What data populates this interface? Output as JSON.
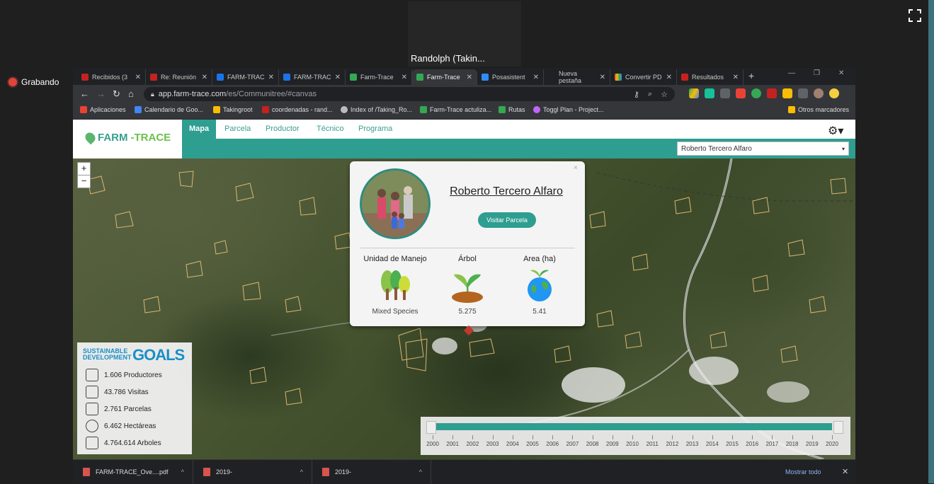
{
  "zoom": {
    "participant_name": "Randolph (Takin...",
    "recording_label": "Grabando"
  },
  "browser": {
    "tabs": [
      {
        "label": "Recibidos (3",
        "fav_color": "#c5221f"
      },
      {
        "label": "Re: Reunión",
        "fav_color": "#c5221f"
      },
      {
        "label": "FARM-TRAC",
        "fav_color": "#1a73e8"
      },
      {
        "label": "FARM-TRAC",
        "fav_color": "#1a73e8"
      },
      {
        "label": "Farm-Trace",
        "fav_color": "#34a853"
      },
      {
        "label": "Farm-Trace",
        "fav_color": "#34a853"
      },
      {
        "label": "Posasistent",
        "fav_color": "#2d8cff"
      },
      {
        "label": "Nueva pestaña",
        "fav_color": "#5f6368"
      },
      {
        "label": "Convertir PD",
        "fav_color": "#fbbc04"
      },
      {
        "label": "Resultados",
        "fav_color": "#c5221f"
      }
    ],
    "url_host": "app.farm-trace.com",
    "url_path": "/es/Communitree/#canvas",
    "bookmarks": [
      {
        "label": "Aplicaciones",
        "fav_color": "#ea4335"
      },
      {
        "label": "Calendario de Goo...",
        "fav_color": "#4285f4"
      },
      {
        "label": "Takingroot",
        "fav_color": "#fbbc04"
      },
      {
        "label": "coordenadas - rand...",
        "fav_color": "#c5221f"
      },
      {
        "label": "Index of /Taking_Ro...",
        "fav_color": "#bbbbbb"
      },
      {
        "label": "Farm-Trace actuliza...",
        "fav_color": "#34a853"
      },
      {
        "label": "Rutas",
        "fav_color": "#34a853"
      },
      {
        "label": "Toggl Plan - Project...",
        "fav_color": "#c264fe"
      }
    ],
    "other_bookmarks": "Otros marcadores"
  },
  "app": {
    "logo_farm": "FARM",
    "logo_trace": "-TRACE",
    "nav": [
      "Mapa",
      "Parcela",
      "Productor",
      "Técnico",
      "Programa"
    ],
    "selected_producer": "Roberto Tercero Alfaro"
  },
  "map": {
    "zoom_in": "+",
    "zoom_out": "−"
  },
  "popup": {
    "close": "×",
    "name": "Roberto Tercero Alfaro",
    "visit_button": "Visitar Parcela",
    "stats": [
      {
        "label": "Unidad de Manejo",
        "value": "Mixed Species",
        "icon": "trees-icon"
      },
      {
        "label": "Árbol",
        "value": "5.275",
        "icon": "sprout-icon"
      },
      {
        "label": "Area (ha)",
        "value": "5.41",
        "icon": "globe-plant-icon"
      }
    ]
  },
  "sdg": {
    "title_line1": "SUSTAINABLE",
    "title_line2": "DEVELOPMENT",
    "goals": "GOALS",
    "rows": [
      {
        "text": "1.606 Productores",
        "icon": "farmer-icon"
      },
      {
        "text": "43.786 Visitas",
        "icon": "clipboard-person-icon"
      },
      {
        "text": "2.761 Parcelas",
        "icon": "group-icon"
      },
      {
        "text": "6.462 Hectáreas",
        "icon": "land-icon"
      },
      {
        "text": "4.764.614 Arboles",
        "icon": "tree-hand-icon"
      }
    ]
  },
  "timeline": {
    "years": [
      "2000",
      "2001",
      "2002",
      "2003",
      "2004",
      "2005",
      "2006",
      "2007",
      "2008",
      "2009",
      "2010",
      "2011",
      "2012",
      "2013",
      "2014",
      "2015",
      "2016",
      "2017",
      "2018",
      "2019",
      "2020"
    ]
  },
  "downloads": {
    "items": [
      "FARM-TRACE_Ove....pdf",
      "2019-",
      "2019-"
    ],
    "show_all": "Mostrar todo"
  }
}
